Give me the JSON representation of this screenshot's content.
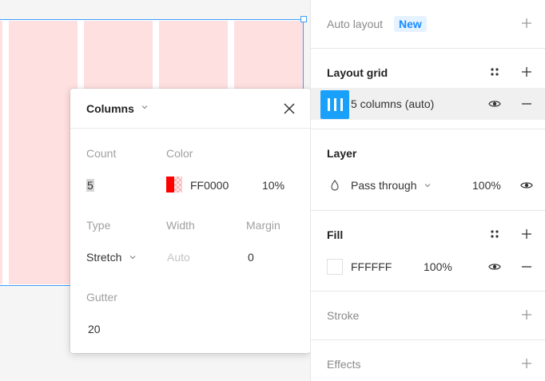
{
  "popover": {
    "title": "Columns",
    "count_label": "Count",
    "count_value": "5",
    "color_label": "Color",
    "color_hex": "FF0000",
    "color_opacity": "10%",
    "type_label": "Type",
    "type_value": "Stretch",
    "width_label": "Width",
    "width_placeholder": "Auto",
    "margin_label": "Margin",
    "margin_value": "0",
    "gutter_label": "Gutter",
    "gutter_value": "20"
  },
  "panel": {
    "auto_layout": {
      "title": "Auto layout",
      "badge": "New"
    },
    "layout_grid": {
      "title": "Layout grid",
      "item_label": "5 columns (auto)"
    },
    "layer": {
      "title": "Layer",
      "blend_mode": "Pass through",
      "opacity": "100%"
    },
    "fill": {
      "title": "Fill",
      "hex": "FFFFFF",
      "opacity": "100%"
    },
    "stroke": {
      "title": "Stroke"
    },
    "effects": {
      "title": "Effects"
    }
  },
  "colors": {
    "accent": "#18a0fb",
    "selection": "#3aa0ff",
    "grid_tint": "#ffe0e0",
    "badge_bg": "#e5f2ff",
    "badge_text": "#1a8cff"
  },
  "icons": [
    "close-icon",
    "chevron-down-icon",
    "plus-icon",
    "minus-icon",
    "eye-icon",
    "drag-dots-icon",
    "layout-grid-icon",
    "blend-drop-icon"
  ]
}
